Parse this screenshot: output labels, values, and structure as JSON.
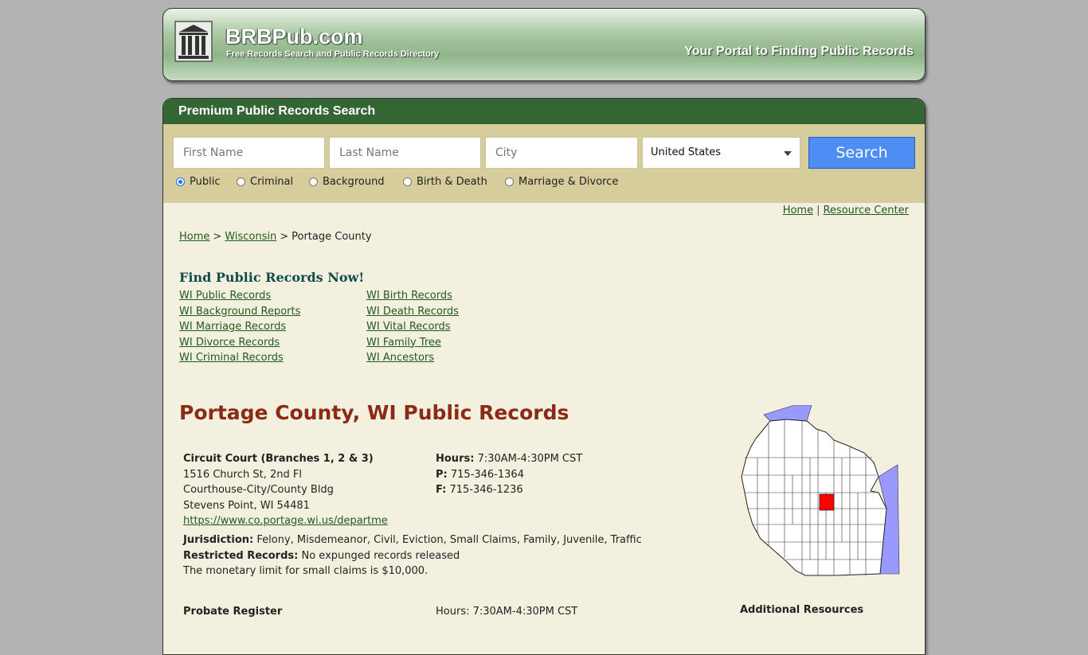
{
  "header": {
    "site_title": "BRBPub.com",
    "tagline": "Free Records Search and Public Records Directory",
    "portal_text": "Your Portal to Finding Public Records"
  },
  "search": {
    "header": "Premium Public Records Search",
    "first_name_placeholder": "First Name",
    "last_name_placeholder": "Last Name",
    "city_placeholder": "City",
    "country_selected": "United States",
    "search_label": "Search",
    "record_types": [
      {
        "label": "Public",
        "checked": true
      },
      {
        "label": "Criminal",
        "checked": false
      },
      {
        "label": "Background",
        "checked": false
      },
      {
        "label": "Birth & Death",
        "checked": false
      },
      {
        "label": "Marriage & Divorce",
        "checked": false
      }
    ]
  },
  "top_nav": {
    "home": "Home",
    "separator": "|",
    "resource_center": "Resource Center"
  },
  "breadcrumb": {
    "home": "Home",
    "state": "Wisconsin",
    "current": "Portage County",
    "separator": ">"
  },
  "find_records": {
    "title": "Find Public Records Now!",
    "left_links": [
      "WI Public Records",
      "WI Background Reports",
      "WI Marriage Records",
      "WI Divorce Records",
      "WI Criminal Records"
    ],
    "right_links": [
      "WI Birth Records",
      "WI Death Records",
      "WI Vital Records",
      "WI Family Tree",
      "WI Ancestors"
    ]
  },
  "county": {
    "title": "Portage County, WI Public Records"
  },
  "court": {
    "name": "Circuit Court (Branches 1, 2 & 3)",
    "address1": "1516 Church St, 2nd Fl",
    "address2": "Courthouse-City/County Bldg",
    "city_state_zip": "Stevens Point, WI 54481",
    "url": "https://www.co.portage.wi.us/departme",
    "hours_label": "Hours:",
    "hours_value": "7:30AM-4:30PM CST",
    "phone_label": "P:",
    "phone_value": "715-346-1364",
    "fax_label": "F:",
    "fax_value": "715-346-1236",
    "jurisdiction_label": "Jurisdiction:",
    "jurisdiction_value": "Felony, Misdemeanor, Civil, Eviction, Small Claims, Family, Juvenile, Traffic",
    "restricted_label": "Restricted Records:",
    "restricted_value": "No expunged records released",
    "note": "The monetary limit for small claims is $10,000."
  },
  "next_section": {
    "name": "Probate Register",
    "hours_value": "Hours: 7:30AM-4:30PM CST",
    "additional_resources": "Additional Resources"
  },
  "icons": {
    "logo": "courthouse-columns-icon",
    "select_arrow": "caret-down-icon",
    "map": "wisconsin-county-map"
  },
  "colors": {
    "search_header": "#336633",
    "search_band": "#d7cc9c",
    "search_button": "#4d8ef5",
    "highlight_county": "#ff0000",
    "lake": "#9999ff",
    "county_title": "#8b2a16"
  }
}
